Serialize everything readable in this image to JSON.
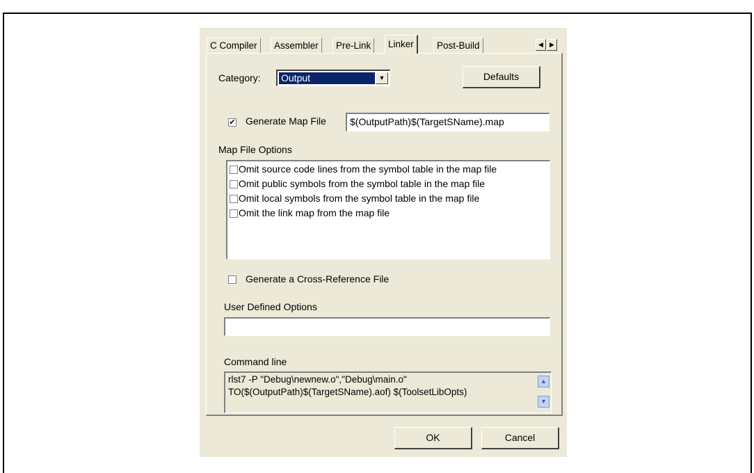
{
  "tabs": [
    "C Compiler",
    "Assembler",
    "Pre-Link",
    "Linker",
    "Post-Build"
  ],
  "active_tab": "Linker",
  "category": {
    "label": "Category:",
    "value": "Output"
  },
  "defaults_label": "Defaults",
  "generate_map": {
    "label": "Generate Map File",
    "checked": true,
    "value": "$(OutputPath)$(TargetSName).map"
  },
  "map_options": {
    "label": "Map File Options",
    "items": [
      "Omit source code lines from the symbol table in the map file",
      "Omit public symbols from the symbol table in the map file",
      "Omit local symbols from the symbol table in the map file",
      "Omit the link map from the map file"
    ]
  },
  "cross_ref": {
    "label": "Generate a Cross-Reference File",
    "checked": false
  },
  "user_options": {
    "label": "User Defined Options",
    "value": ""
  },
  "command_line": {
    "label": "Command line",
    "lines": [
      "rlst7 -P \"Debug\\newnew.o\",\"Debug\\main.o\"",
      "TO($(OutputPath)$(TargetSName).aof) $(ToolsetLibOpts)"
    ]
  },
  "ok_label": "OK",
  "cancel_label": "Cancel"
}
